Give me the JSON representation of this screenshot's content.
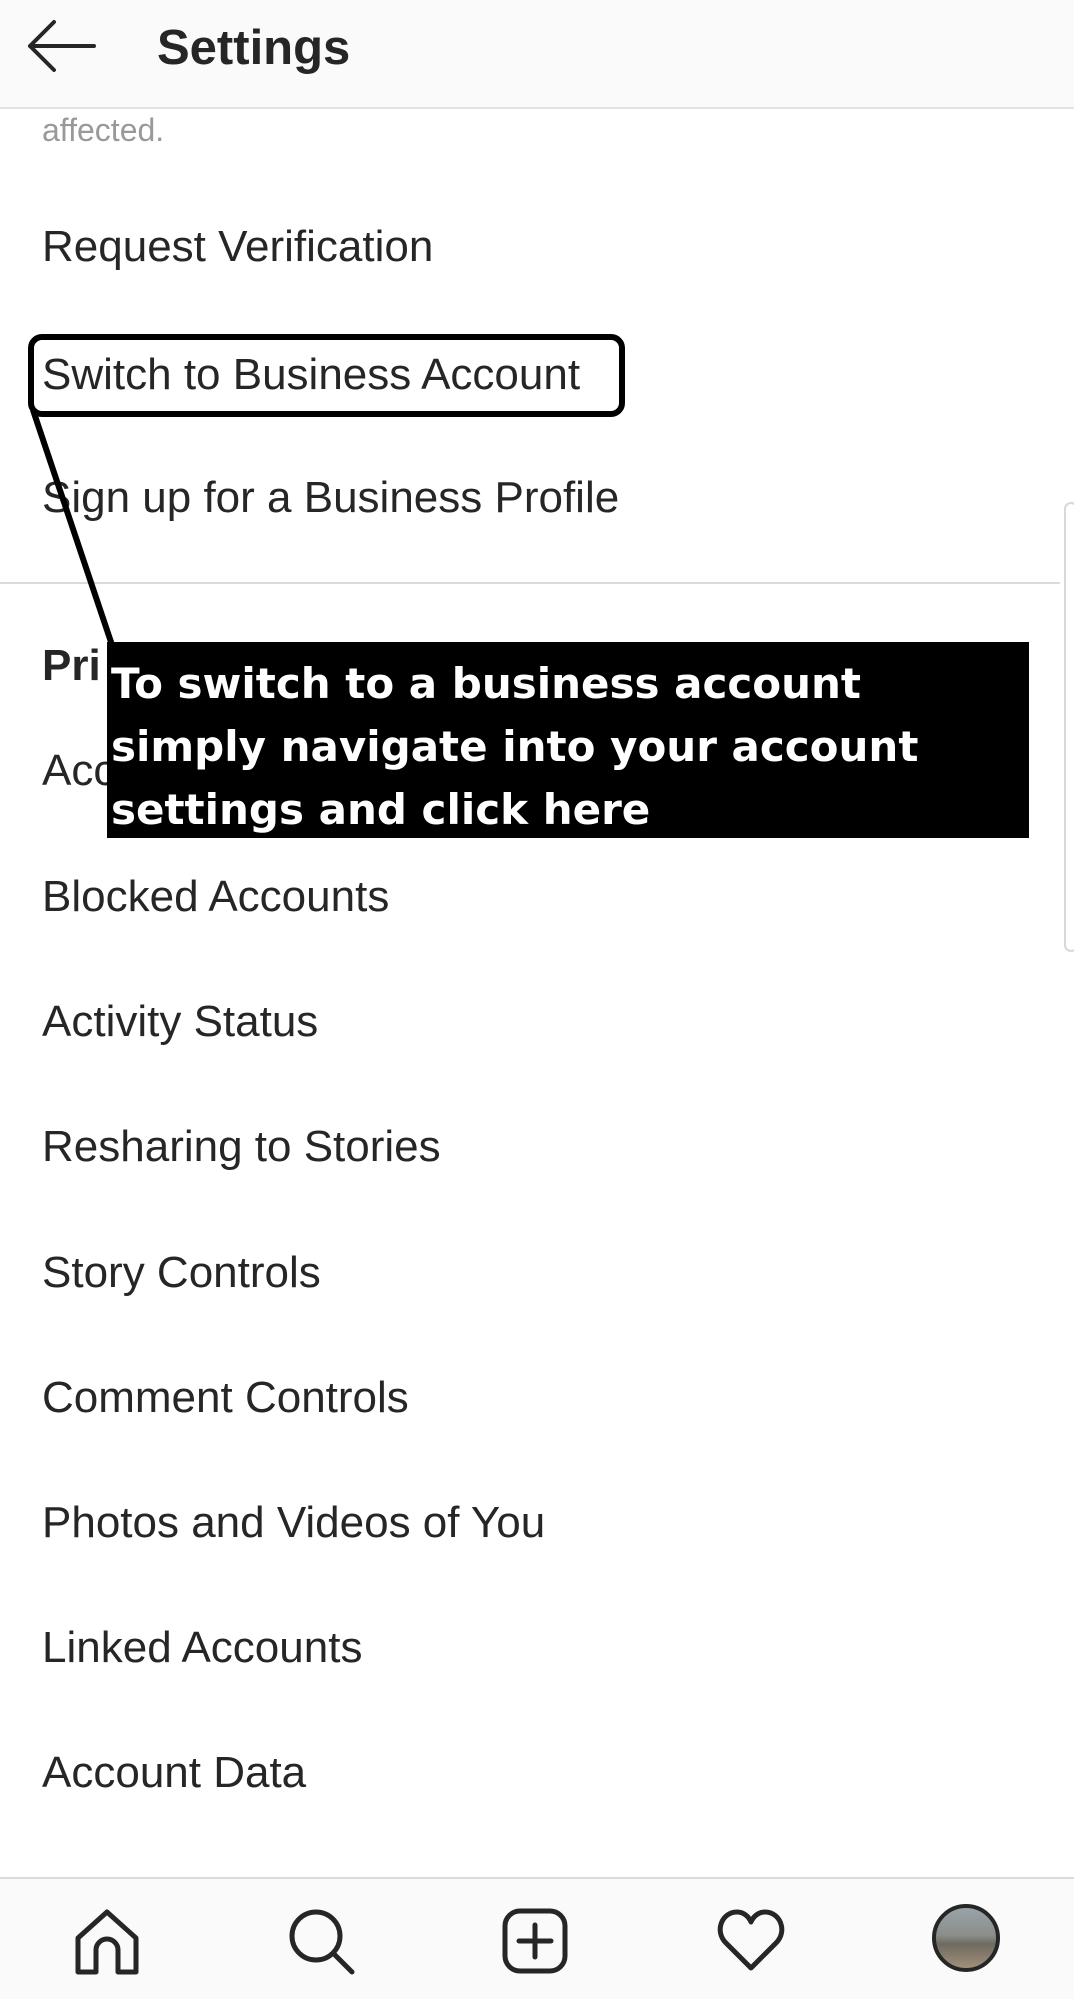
{
  "header": {
    "title": "Settings",
    "back_icon": "arrow-left-icon"
  },
  "faded_text": "affected.",
  "business_items": [
    "Request Verification",
    "Switch to Business Account",
    "Sign up for a Business Profile"
  ],
  "privacy": {
    "section_header_visible": "Pri",
    "partial_item_visible": "Acc",
    "items": [
      "Blocked Accounts",
      "Activity Status",
      "Resharing to Stories",
      "Story Controls",
      "Comment Controls",
      "Photos and Videos of You",
      "Linked Accounts",
      "Account Data"
    ]
  },
  "callout": {
    "text": "To switch to a business account simply navigate into your account settings and click here",
    "highlighted_item": "Switch to Business Account",
    "background": "#000000",
    "text_color": "#ffffff"
  },
  "bottom_nav": {
    "icons": [
      "home-icon",
      "search-icon",
      "add-post-icon",
      "heart-icon",
      "profile-avatar"
    ]
  },
  "colors": {
    "text": "#262626",
    "muted": "#999999",
    "divider": "#dbdbdb",
    "bar_bg": "#fafafa"
  }
}
